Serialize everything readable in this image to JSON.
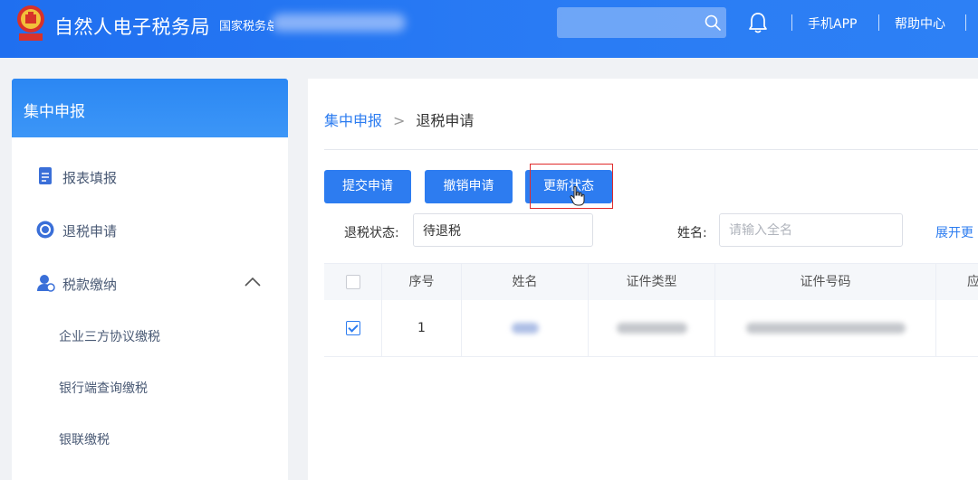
{
  "header": {
    "title": "自然人电子税务局",
    "subtitle": "国家税务总",
    "search_placeholder": "",
    "links": [
      {
        "label": "手机APP"
      },
      {
        "label": "帮助中心"
      }
    ]
  },
  "sidebar": {
    "heading": "集中申报",
    "items": [
      {
        "label": "报表填报",
        "icon": "document-icon"
      },
      {
        "label": "退税申请",
        "icon": "tax-refund-icon"
      },
      {
        "label": "税款缴纳",
        "icon": "user-payment-icon",
        "expanded": true
      }
    ],
    "subitems": [
      {
        "label": "企业三方协议缴税"
      },
      {
        "label": "银行端查询缴税"
      },
      {
        "label": "银联缴税"
      }
    ]
  },
  "main": {
    "breadcrumb": {
      "parent": "集中申报",
      "separator": ">",
      "current": "退税申请"
    },
    "buttons": {
      "submit": "提交申请",
      "revoke": "撤销申请",
      "refresh": "更新状态"
    },
    "filters": {
      "status_label": "退税状态:",
      "status_value": "待退税",
      "name_label": "姓名:",
      "name_placeholder": "请输入全名",
      "expand_label": "展开更"
    },
    "table": {
      "columns": [
        "序号",
        "姓名",
        "证件类型",
        "证件号码",
        "应"
      ],
      "rows": [
        {
          "index": "1",
          "checked": true
        }
      ]
    }
  },
  "colors": {
    "header_blue": "#2a7cf4",
    "primary_button": "#2d7cf0",
    "highlight_red": "#e02b2b"
  }
}
